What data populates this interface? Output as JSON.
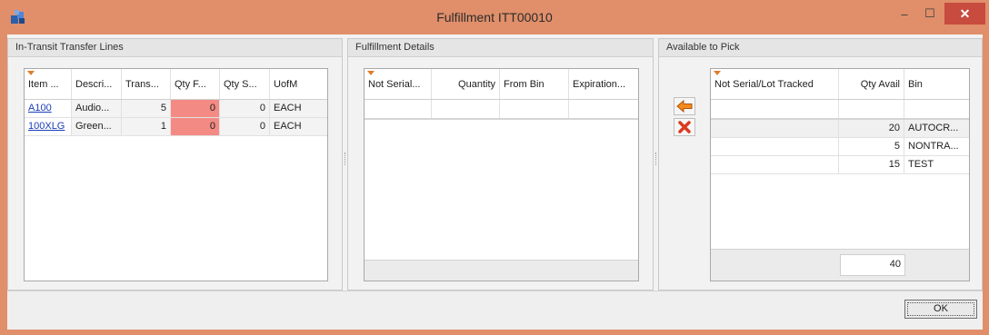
{
  "window": {
    "title": "Fulfillment ITT00010",
    "minimize_glyph": "–",
    "maximize_glyph": "☐",
    "close_glyph": "✕",
    "icon": "app-logo-icon"
  },
  "transfer_lines": {
    "title": "In-Transit Transfer Lines",
    "columns": [
      "Item ...",
      "Descri...",
      "Trans...",
      "Qty F...",
      "Qty S...",
      "UofM"
    ],
    "rows": [
      {
        "item": "A100",
        "description": "Audio...",
        "transfer": "5",
        "qty_fulfilled": "0",
        "qty_shipped": "0",
        "uofm": "EACH"
      },
      {
        "item": "100XLG",
        "description": "Green...",
        "transfer": "1",
        "qty_fulfilled": "0",
        "qty_shipped": "0",
        "uofm": "EACH"
      }
    ]
  },
  "fulfillment_details": {
    "title": "Fulfillment Details",
    "columns": [
      "Not Serial...",
      "Quantity",
      "From Bin",
      "Expiration..."
    ]
  },
  "available_to_pick": {
    "title": "Available to Pick",
    "columns": [
      "Not Serial/Lot Tracked",
      "Qty Avail",
      "Bin"
    ],
    "rows": [
      {
        "tracked": "",
        "qty_avail": "20",
        "bin": "AUTOCR..."
      },
      {
        "tracked": "",
        "qty_avail": "5",
        "bin": "NONTRA..."
      },
      {
        "tracked": "",
        "qty_avail": "15",
        "bin": "TEST"
      }
    ],
    "total_qty": "40"
  },
  "actions": {
    "add_icon": "arrow-left-icon",
    "remove_icon": "red-x-icon"
  },
  "colors": {
    "title_bar": "#e08f6a",
    "highlight_red": "#f48a84",
    "sort_marker": "#e07d2a",
    "link": "#1a3db8"
  },
  "ok_label": "OK"
}
